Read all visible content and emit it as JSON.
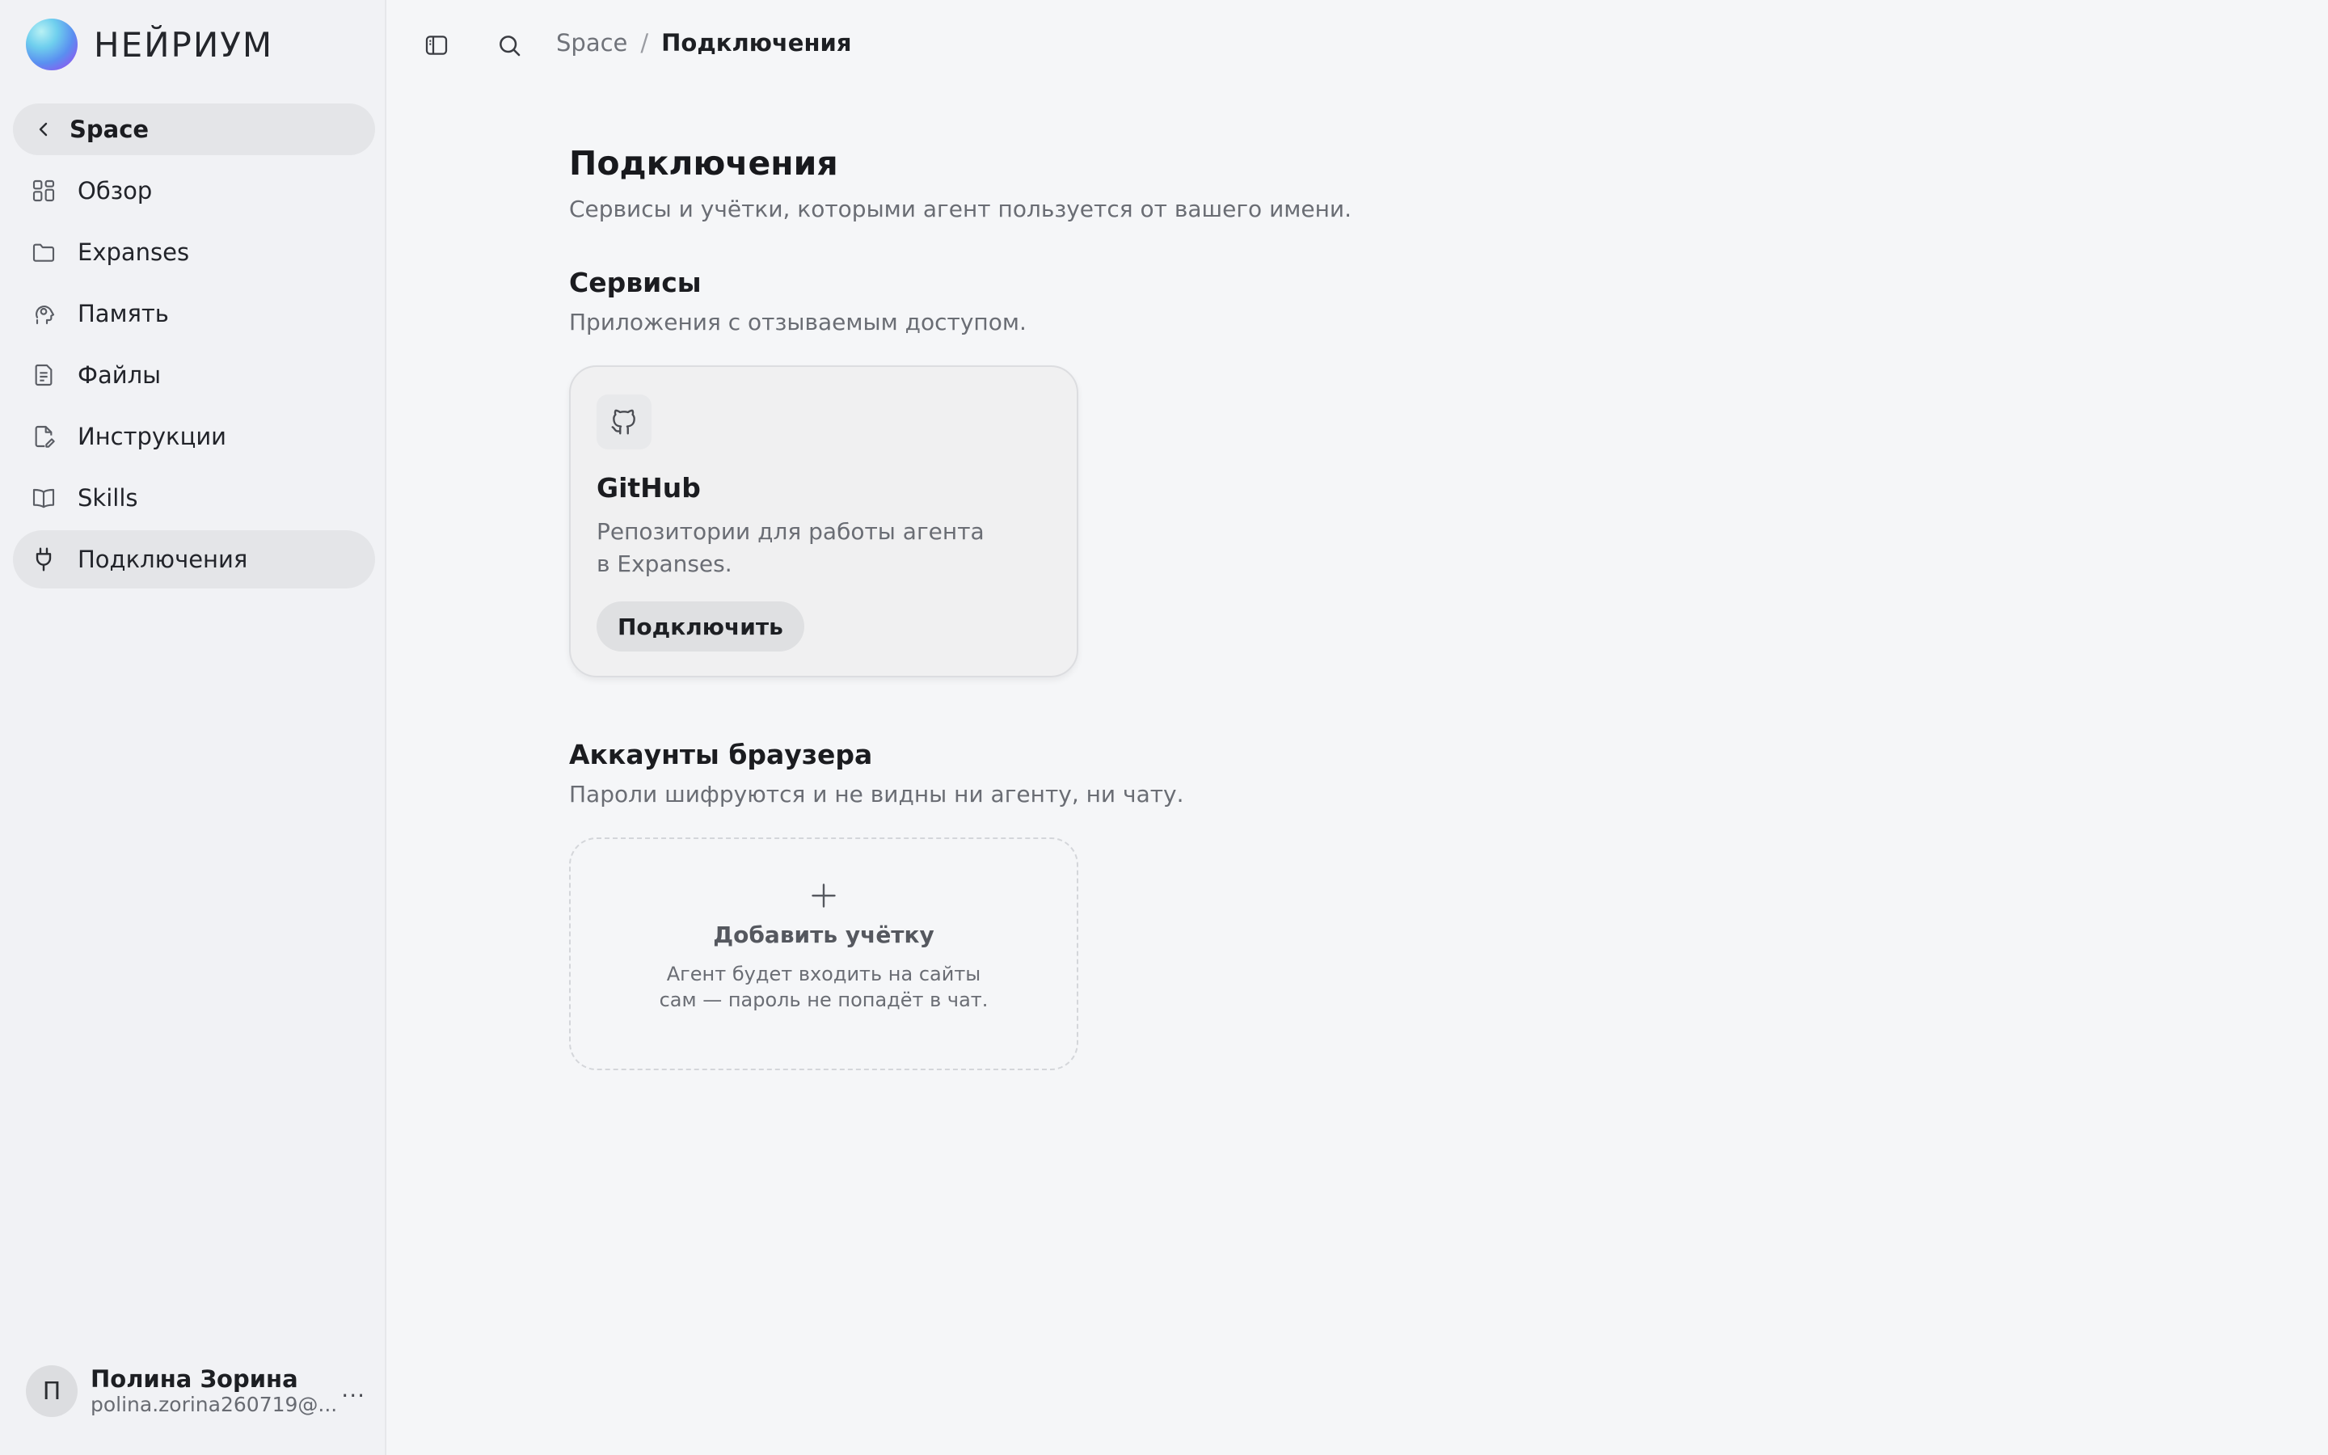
{
  "brand": {
    "name": "НЕЙРИУМ"
  },
  "sidebar": {
    "back_label": "Space",
    "items": [
      {
        "label": "Обзор",
        "icon": "grid-icon"
      },
      {
        "label": "Expanses",
        "icon": "folder-icon"
      },
      {
        "label": "Память",
        "icon": "head-icon"
      },
      {
        "label": "Файлы",
        "icon": "file-icon"
      },
      {
        "label": "Инструкции",
        "icon": "edit-file-icon"
      },
      {
        "label": "Skills",
        "icon": "book-icon"
      },
      {
        "label": "Подключения",
        "icon": "plug-icon",
        "active": true
      }
    ]
  },
  "user": {
    "initial": "П",
    "name": "Полина Зорина",
    "email": "polina.zorina260719@...",
    "more": "···"
  },
  "breadcrumb": {
    "parent": "Space",
    "separator": "/",
    "current": "Подключения"
  },
  "page": {
    "title": "Подключения",
    "subtitle": "Сервисы и учётки, которыми агент пользуется от вашего имени."
  },
  "services": {
    "title": "Сервисы",
    "subtitle": "Приложения с отзываемым доступом.",
    "github": {
      "name": "GitHub",
      "description_line1": "Репозитории для работы агента",
      "description_line2": "в Expanses.",
      "button": "Подключить",
      "icon": "github-icon"
    }
  },
  "browser_accounts": {
    "title": "Аккаунты браузера",
    "subtitle": "Пароли шифруются и не видны ни агенту, ни чату.",
    "add_title": "Добавить учётку",
    "add_desc_line1": "Агент будет входить на сайты",
    "add_desc_line2": "сам — пароль не попадёт в чат."
  },
  "colors": {
    "background": "#f5f6f8",
    "sidebar": "#f1f2f5",
    "active": "#e4e5e8"
  }
}
